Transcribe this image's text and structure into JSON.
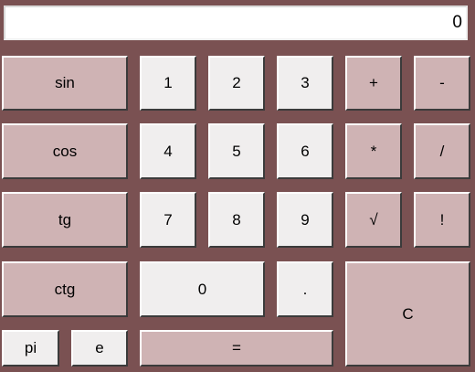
{
  "display": {
    "value": "0"
  },
  "buttons": {
    "sin": "sin",
    "cos": "cos",
    "tg": "tg",
    "ctg": "ctg",
    "pi": "pi",
    "e": "e",
    "d1": "1",
    "d2": "2",
    "d3": "3",
    "d4": "4",
    "d5": "5",
    "d6": "6",
    "d7": "7",
    "d8": "8",
    "d9": "9",
    "d0": "0",
    "dot": ".",
    "equals": "=",
    "plus": "+",
    "minus": "-",
    "multiply": "*",
    "divide": "/",
    "sqrt": "√",
    "factorial": "!",
    "clear": "C"
  },
  "colors": {
    "background": "#7a5152",
    "function_button": "#cfb3b4",
    "digit_button": "#f0eeee"
  }
}
